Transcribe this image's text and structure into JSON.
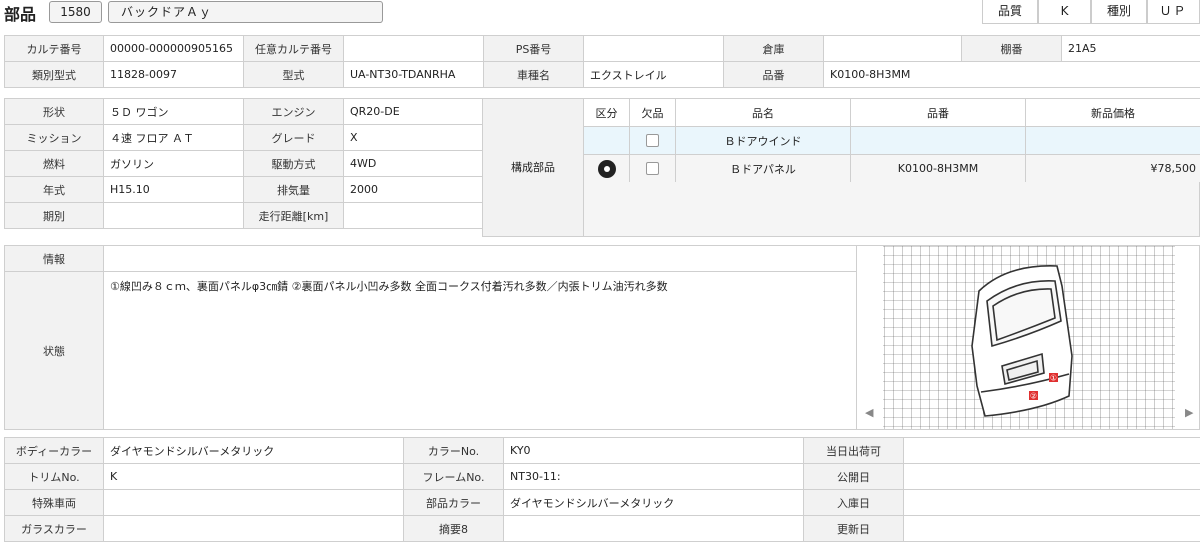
{
  "header": {
    "title": "部品",
    "code": "1580",
    "name": "バックドアＡｙ",
    "quality_label": "品質",
    "quality_value": "K",
    "kind_label": "種別",
    "kind_value": "ＵＰ"
  },
  "top": {
    "carte_no_label": "カルテ番号",
    "carte_no": "00000-000000905165",
    "optional_carte_label": "任意カルテ番号",
    "optional_carte": "",
    "ps_no_label": "PS番号",
    "ps_no": "",
    "warehouse_label": "倉庫",
    "warehouse": "",
    "shelf_label": "棚番",
    "shelf": "21A5",
    "class_model_label": "類別型式",
    "class_model": "11828-0097",
    "model_label": "型式",
    "model": "UA-NT30-TDANRHA",
    "car_name_label": "車種名",
    "car_name": "エクストレイル",
    "part_no_label": "品番",
    "part_no": "K0100-8H3MM"
  },
  "spec": {
    "shape_label": "形状",
    "shape": "５Ｄ ワゴン",
    "engine_label": "エンジン",
    "engine": "QR20-DE",
    "mission_label": "ミッション",
    "mission": "４速 フロア ＡＴ",
    "grade_label": "グレード",
    "grade": "X",
    "fuel_label": "燃料",
    "fuel": "ガソリン",
    "drive_label": "駆動方式",
    "drive": "4WD",
    "year_label": "年式",
    "year": "H15.10",
    "displacement_label": "排気量",
    "displacement": "2000",
    "period_label": "期別",
    "period": "",
    "mileage_label": "走行距離[km]",
    "mileage": ""
  },
  "composed": {
    "label": "構成部品",
    "headers": {
      "kubun": "区分",
      "missing": "欠品",
      "name": "品名",
      "part_no": "品番",
      "price": "新品価格"
    },
    "rows": [
      {
        "name": "Ｂドアウインド",
        "part_no": "",
        "price": ""
      },
      {
        "name": "Ｂドアパネル",
        "part_no": "K0100-8H3MM",
        "price": "¥78,500"
      }
    ]
  },
  "info": {
    "info_label": "情報",
    "info": "",
    "status_label": "状態",
    "status": "①線凹み８ｃｍ、裏面パネルφ3㎝錆\n②裏面パネル小凹み多数\n全面コークス付着汚れ多数／内張トリム油汚れ多数",
    "marker1": "①",
    "marker2": "②"
  },
  "bottom": {
    "body_color_label": "ボディーカラー",
    "body_color": "ダイヤモンドシルバーメタリック",
    "color_no_label": "カラーNo.",
    "color_no": "KY0",
    "ship_today_label": "当日出荷可",
    "ship_today": "",
    "trim_no_label": "トリムNo.",
    "trim_no": "K",
    "frame_no_label": "フレームNo.",
    "frame_no": "NT30-11:",
    "publish_date_label": "公開日",
    "publish_date": "",
    "special_label": "特殊車両",
    "special": "",
    "part_color_label": "部品カラー",
    "part_color": "ダイヤモンドシルバーメタリック",
    "arrival_date_label": "入庫日",
    "arrival_date": "",
    "glass_color_label": "ガラスカラー",
    "glass_color": "",
    "summary_label": "摘要8",
    "summary": "",
    "update_date_label": "更新日",
    "update_date": ""
  },
  "icons": {
    "disc": "disc-icon",
    "left": "arrow-left-icon",
    "right": "arrow-right-icon"
  },
  "colors": {
    "label_bg": "#f2f2f2",
    "row_highlight": "#eaf6fc",
    "marker": "#e03030"
  }
}
